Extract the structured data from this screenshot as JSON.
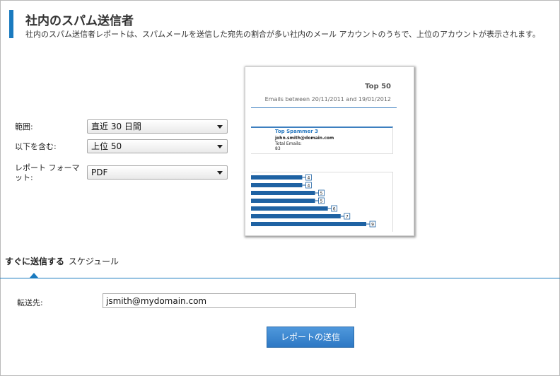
{
  "header": {
    "title": "社内のスパム送信者",
    "description": "社内のスパム送信者レポートは、スパムメールを送信した宛先の割合が多い社内のメール アカウントのうちで、上位のアカウントが表示されます。"
  },
  "form": {
    "range_label": "範囲:",
    "range_value": "直近 30 日間",
    "include_label": "以下を含む:",
    "include_value": "上位 50",
    "format_label": "レポート フォーマット:",
    "format_value": "PDF"
  },
  "preview": {
    "title": "Top 50",
    "subtitle": "Emails between 20/11/2011 and 19/01/2012",
    "card": {
      "title": "Top Spammer 3",
      "email": "john.smith@domain.com",
      "total_label": "Total Emails:",
      "total_value": "83"
    }
  },
  "chart_data": {
    "type": "bar",
    "orientation": "horizontal",
    "values": [
      4,
      4,
      5,
      5,
      6,
      7,
      9
    ],
    "data_labels": [
      "4",
      "4",
      "5",
      "5",
      "6",
      "7",
      "9"
    ],
    "color": "#1e62a3"
  },
  "tabs": {
    "send_now": "すぐに送信する",
    "schedule": "スケジュール"
  },
  "send": {
    "to_label": "転送先:",
    "to_value": "jsmith@mydomain.com",
    "button_label": "レポートの送信"
  },
  "colors": {
    "accent": "#1a7abf",
    "button": "#2d78c4"
  }
}
